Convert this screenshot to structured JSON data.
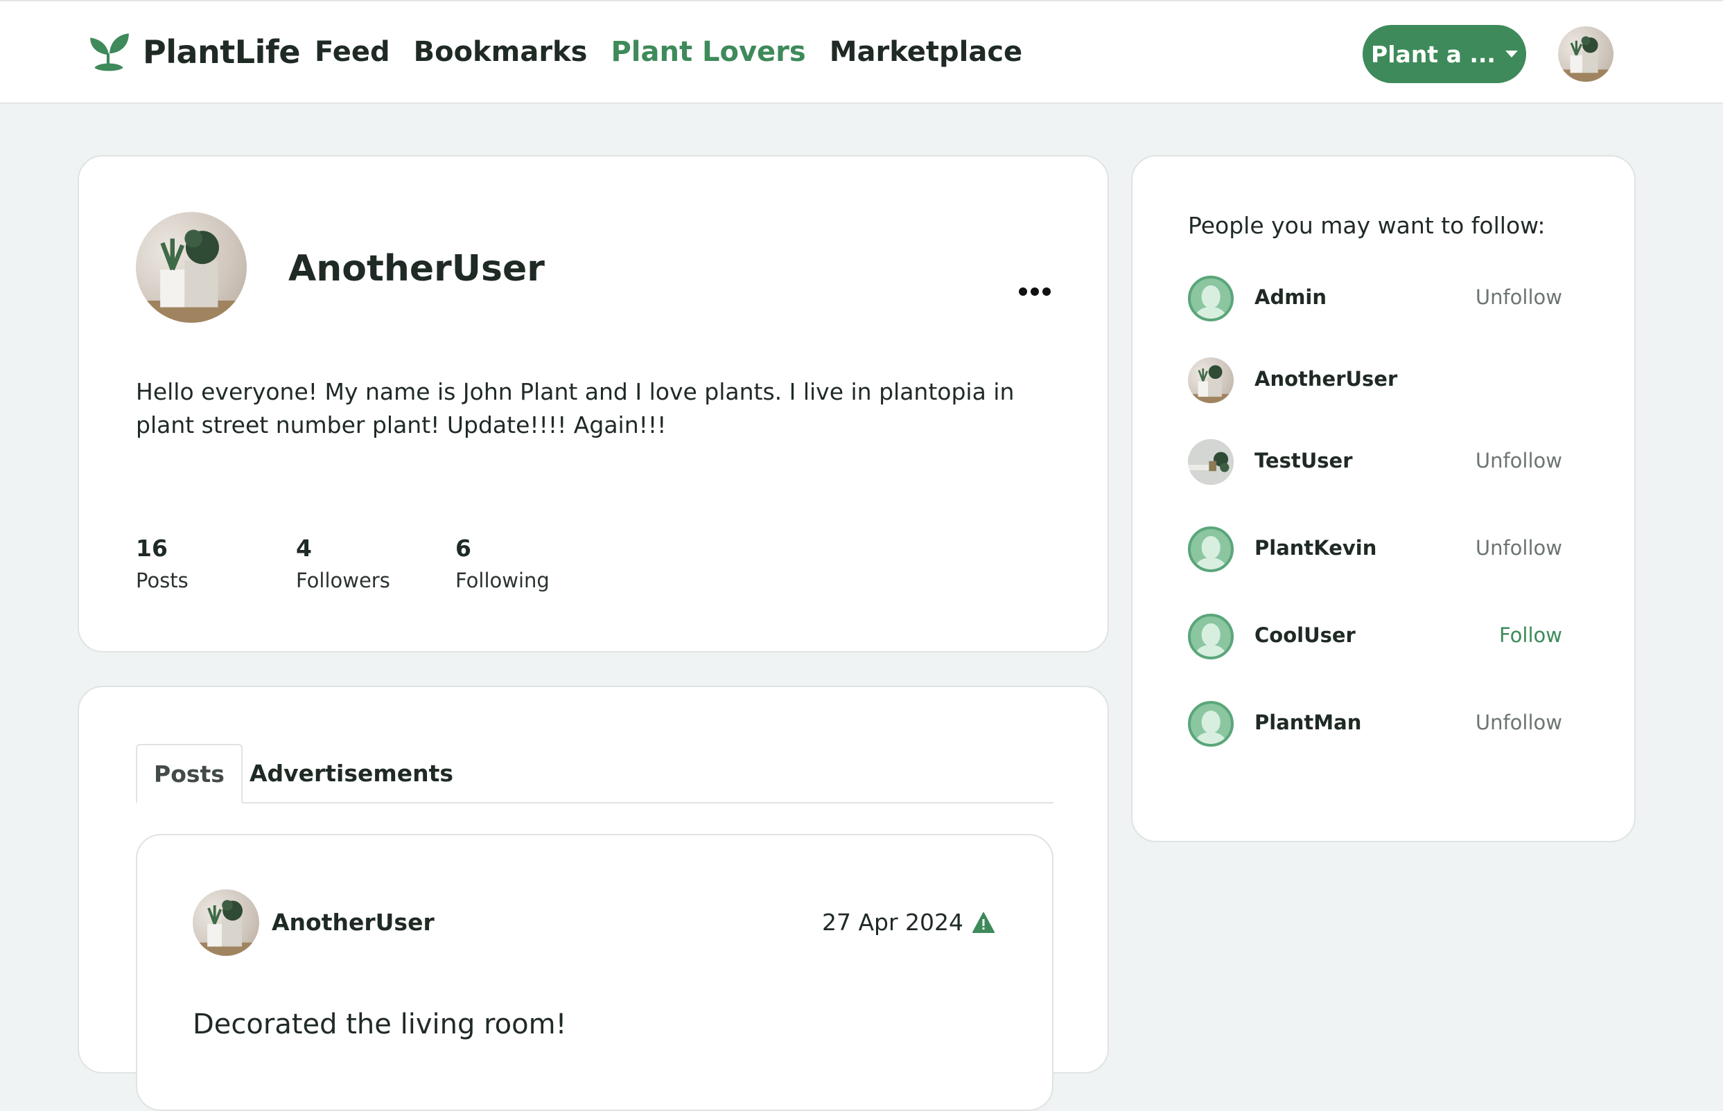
{
  "brand": {
    "name": "PlantLife"
  },
  "nav": {
    "items": [
      {
        "label": "Feed"
      },
      {
        "label": "Bookmarks"
      },
      {
        "label": "Plant Lovers"
      },
      {
        "label": "Marketplace"
      }
    ],
    "active": "Plant Lovers"
  },
  "header": {
    "plant_button_label": "Plant a ..."
  },
  "profile": {
    "username": "AnotherUser",
    "bio": "Hello everyone! My name is John Plant and I love plants. I live in plantopia in plant street number plant! Update!!!! Again!!!",
    "stats": [
      {
        "value": "16",
        "label": "Posts"
      },
      {
        "value": "4",
        "label": "Followers"
      },
      {
        "value": "6",
        "label": "Following"
      }
    ]
  },
  "tabs": [
    {
      "label": "Posts",
      "active": true
    },
    {
      "label": "Advertisements",
      "active": false
    }
  ],
  "post": {
    "author": "AnotherUser",
    "date": "27 Apr 2024",
    "title": "Decorated the living room!"
  },
  "suggestions": {
    "title": "People you may want to follow:",
    "people": [
      {
        "name": "Admin",
        "action": "Unfollow",
        "avatar": "default"
      },
      {
        "name": "AnotherUser",
        "action": "",
        "avatar": "plant"
      },
      {
        "name": "TestUser",
        "action": "Unfollow",
        "avatar": "plant"
      },
      {
        "name": "PlantKevin",
        "action": "Unfollow",
        "avatar": "default"
      },
      {
        "name": "CoolUser",
        "action": "Follow",
        "avatar": "default"
      },
      {
        "name": "PlantMan",
        "action": "Unfollow",
        "avatar": "default"
      }
    ]
  },
  "colors": {
    "accent": "#3e8a5a",
    "background": "#f0f3f4",
    "card": "#ffffff"
  }
}
